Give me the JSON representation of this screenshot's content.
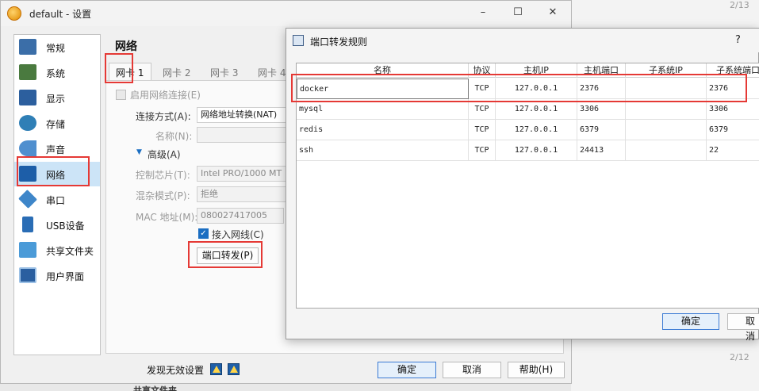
{
  "window": {
    "title": "default - 设置",
    "minimize": "–",
    "maximize": "☐",
    "close": "✕"
  },
  "sidebar": {
    "items": [
      {
        "label": "常规",
        "icon": "general-icon",
        "color": "#3b6ea8"
      },
      {
        "label": "系统",
        "icon": "system-icon",
        "color": "#4a7a3f"
      },
      {
        "label": "显示",
        "icon": "display-icon",
        "color": "#2c5f9e"
      },
      {
        "label": "存储",
        "icon": "storage-icon",
        "color": "#2f7fb6"
      },
      {
        "label": "声音",
        "icon": "audio-icon",
        "color": "#4f8fcf"
      },
      {
        "label": "网络",
        "icon": "network-icon",
        "color": "#1d5ea8"
      },
      {
        "label": "串口",
        "icon": "serial-icon",
        "color": "#3e86c9"
      },
      {
        "label": "USB设备",
        "icon": "usb-icon",
        "color": "#2a6db5"
      },
      {
        "label": "共享文件夹",
        "icon": "shared-folder-icon",
        "color": "#4b9bd8"
      },
      {
        "label": "用户界面",
        "icon": "user-interface-icon",
        "color": "#2a5fa0"
      }
    ]
  },
  "section": {
    "title": "网络"
  },
  "tabs": [
    "网卡 1",
    "网卡 2",
    "网卡 3",
    "网卡 4"
  ],
  "adapter": {
    "enable_label": "启用网络连接(E)",
    "attached_label": "连接方式(A):",
    "attached_value": "网络地址转换(NAT)",
    "name_label": "名称(N):",
    "name_value": "",
    "advanced_label": "高级(A)",
    "chip_label": "控制芯片(T):",
    "chip_value": "Intel PRO/1000 MT",
    "promisc_label": "混杂模式(P):",
    "promisc_value": "拒绝",
    "mac_label": "MAC 地址(M):",
    "mac_value": "080027417005",
    "cable_label": "接入网线(C)",
    "port_forward_button": "端口转发(P)"
  },
  "footer": {
    "invalid_settings_label": "发现无效设置",
    "ok": "确定",
    "cancel": "取消",
    "help": "帮助(H)"
  },
  "pf_dialog": {
    "title": "端口转发规则",
    "help": "?",
    "columns": [
      "名称",
      "协议",
      "主机IP",
      "主机端口",
      "子系统IP",
      "子系统端口"
    ],
    "rows": [
      {
        "name": "docker",
        "protocol": "TCP",
        "host_ip": "127.0.0.1",
        "host_port": "2376",
        "guest_ip": "",
        "guest_port": "2376"
      },
      {
        "name": "mysql",
        "protocol": "TCP",
        "host_ip": "127.0.0.1",
        "host_port": "3306",
        "guest_ip": "",
        "guest_port": "3306"
      },
      {
        "name": "redis",
        "protocol": "TCP",
        "host_ip": "127.0.0.1",
        "host_port": "6379",
        "guest_ip": "",
        "guest_port": "6379"
      },
      {
        "name": "ssh",
        "protocol": "TCP",
        "host_ip": "127.0.0.1",
        "host_port": "24413",
        "guest_ip": "",
        "guest_port": "22"
      }
    ],
    "ok": "确定",
    "cancel": "取消"
  },
  "background": {
    "frag_top": "2/13",
    "frag_bottom": "2/12",
    "frag_bottom_text": "共享文件夹"
  },
  "colors": {
    "highlight": "#e53935",
    "accent": "#1b6ec2",
    "selection": "#cce4f7"
  }
}
